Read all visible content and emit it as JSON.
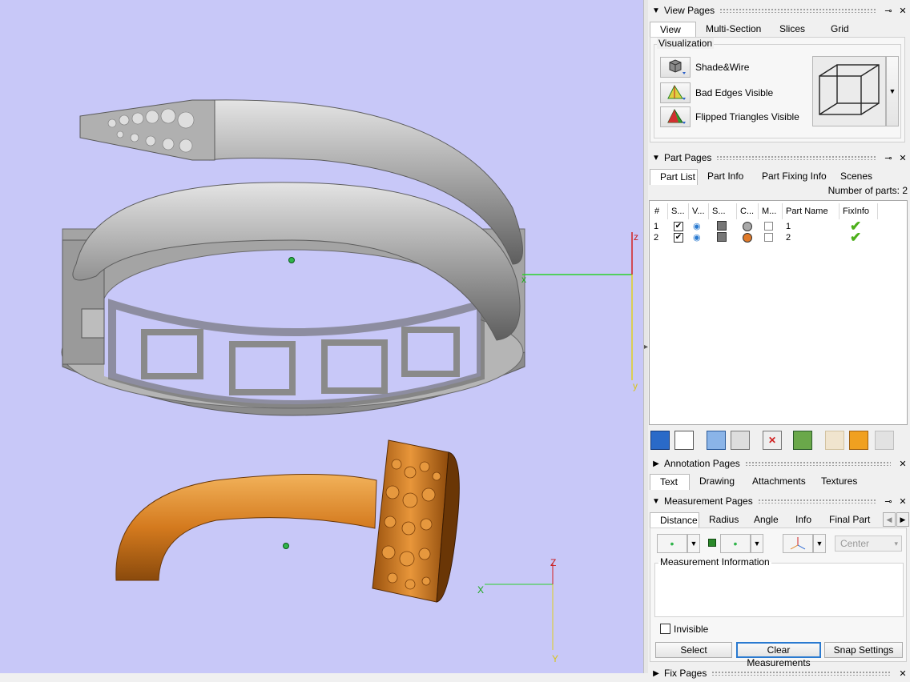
{
  "viewport": {
    "axis_labels": {
      "z_upper": "z",
      "x_upper": "x",
      "y_upper": "y",
      "z_lower": "Z",
      "x_lower": "X",
      "y_lower": "Y"
    },
    "part_colors": {
      "silver": "#a9a9a9",
      "gold": "#d9862a",
      "background": "#c8c8f8"
    }
  },
  "view_pages": {
    "title": "View Pages",
    "tabs": [
      "View",
      "Multi-Section",
      "Slices",
      "Grid"
    ],
    "active_tab": "View",
    "group_title": "Visualization",
    "options": [
      {
        "label": "Shade&Wire",
        "icon": "cube-shade-icon"
      },
      {
        "label": "Bad Edges Visible",
        "icon": "triangle-bad-edges-icon"
      },
      {
        "label": "Flipped Triangles Visible",
        "icon": "triangle-flipped-icon"
      }
    ]
  },
  "part_pages": {
    "title": "Part Pages",
    "tabs": [
      "Part List",
      "Part Info",
      "Part Fixing Info",
      "Scenes"
    ],
    "active_tab": "Part List",
    "number_of_parts": "Number of parts: 2",
    "columns": [
      "#",
      "S...",
      "V...",
      "S...",
      "C...",
      "M...",
      "Part Name",
      "FixInfo"
    ],
    "rows": [
      {
        "num": "1",
        "name": "1",
        "color": "#a9a9a9"
      },
      {
        "num": "2",
        "name": "2",
        "color": "#e07a2a"
      }
    ]
  },
  "annotation_pages": {
    "title": "Annotation Pages",
    "tabs": [
      "Text",
      "Drawing",
      "Attachments",
      "Textures"
    ],
    "active_tab": "Text"
  },
  "measurement_pages": {
    "title": "Measurement Pages",
    "tabs": [
      "Distance",
      "Radius",
      "Angle",
      "Info",
      "Final Part"
    ],
    "active_tab": "Distance",
    "center_select": "Center",
    "group_title": "Measurement Information",
    "invisible_label": "Invisible",
    "buttons": {
      "select": "Select",
      "clear": "Clear Measurements",
      "snap": "Snap Settings"
    }
  },
  "fix_pages": {
    "title": "Fix Pages"
  }
}
